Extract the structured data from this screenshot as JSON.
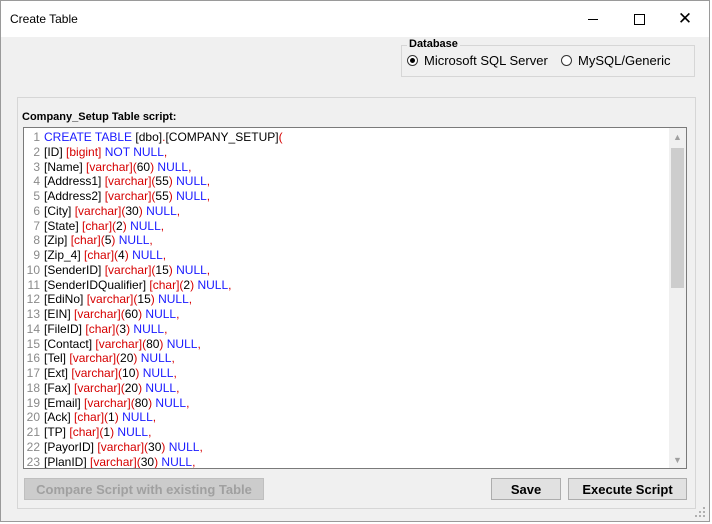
{
  "window": {
    "title": "Create Table",
    "controls": {
      "minimize": "minimize",
      "maximize": "maximize",
      "close": "✕"
    }
  },
  "database": {
    "group_label": "Database",
    "options": [
      {
        "label": "Microsoft SQL Server",
        "selected": true
      },
      {
        "label": "MySQL/Generic",
        "selected": false
      }
    ]
  },
  "script": {
    "label": "Company_Setup Table script:",
    "lines": [
      {
        "n": "1",
        "text": "CREATE TABLE [dbo].[COMPANY_SETUP]("
      },
      {
        "n": "2",
        "text": "[ID] [bigint] NOT NULL,"
      },
      {
        "n": "3",
        "text": "[Name] [varchar](60) NULL,"
      },
      {
        "n": "4",
        "text": "[Address1] [varchar](55) NULL,"
      },
      {
        "n": "5",
        "text": "[Address2] [varchar](55) NULL,"
      },
      {
        "n": "6",
        "text": "[City] [varchar](30) NULL,"
      },
      {
        "n": "7",
        "text": "[State] [char](2) NULL,"
      },
      {
        "n": "8",
        "text": "[Zip] [char](5) NULL,"
      },
      {
        "n": "9",
        "text": "[Zip_4] [char](4) NULL,"
      },
      {
        "n": "10",
        "text": "[SenderID] [varchar](15) NULL,"
      },
      {
        "n": "11",
        "text": "[SenderIDQualifier] [char](2) NULL,"
      },
      {
        "n": "12",
        "text": "[EdiNo] [varchar](15) NULL,"
      },
      {
        "n": "13",
        "text": "[EIN] [varchar](60) NULL,"
      },
      {
        "n": "14",
        "text": "[FileID] [char](3) NULL,"
      },
      {
        "n": "15",
        "text": "[Contact] [varchar](80) NULL,"
      },
      {
        "n": "16",
        "text": "[Tel] [varchar](20) NULL,"
      },
      {
        "n": "17",
        "text": "[Ext] [varchar](10) NULL,"
      },
      {
        "n": "18",
        "text": "[Fax] [varchar](20) NULL,"
      },
      {
        "n": "19",
        "text": "[Email] [varchar](80) NULL,"
      },
      {
        "n": "20",
        "text": "[Ack] [char](1) NULL,"
      },
      {
        "n": "21",
        "text": "[TP] [char](1) NULL,"
      },
      {
        "n": "22",
        "text": "[PayorID] [varchar](30) NULL,"
      },
      {
        "n": "23",
        "text": "[PlanID] [varchar](30) NULL,"
      }
    ]
  },
  "buttons": {
    "compare": "Compare Script with existing Table",
    "save": "Save",
    "execute": "Execute Script"
  }
}
